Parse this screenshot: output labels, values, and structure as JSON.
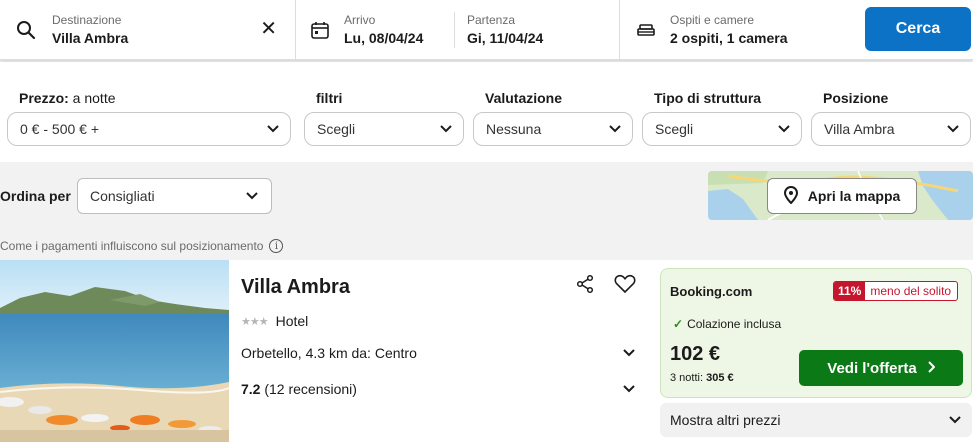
{
  "search": {
    "destination_label": "Destinazione",
    "destination_value": "Villa Ambra",
    "checkin_label": "Arrivo",
    "checkin_value": "Lu, 08/04/24",
    "checkout_label": "Partenza",
    "checkout_value": "Gi, 11/04/24",
    "guests_label": "Ospiti e camere",
    "guests_value": "2 ospiti, 1 camera",
    "search_button": "Cerca"
  },
  "filters": {
    "price_label": "Prezzo:",
    "price_sub": " a notte",
    "price_value": "0 € - 500 € +",
    "filters_label": "filtri",
    "filters_value": "Scegli",
    "rating_label": "Valutazione",
    "rating_value": "Nessuna",
    "type_label": "Tipo di struttura",
    "type_value": "Scegli",
    "position_label": "Posizione",
    "position_value": "Villa Ambra"
  },
  "sort": {
    "label": "Ordina per",
    "value": "Consigliati",
    "map_button": "Apri la mappa",
    "payment_note": "Come i pagamenti influiscono sul posizionamento"
  },
  "result": {
    "name": "Villa Ambra",
    "stars": 3,
    "star_glyphs": "★★★",
    "type": "Hotel",
    "location": "Orbetello, 4.3 km da: Centro",
    "rating_score": "7.2",
    "rating_count": "(12 recensioni)",
    "provider": "Booking.com",
    "deal_pct": "11%",
    "deal_text": "meno del solito",
    "breakfast": "Colazione inclusa",
    "price": "102 €",
    "total_prefix": "3 notti:",
    "total_value": "305 €",
    "offer_button": "Vedi l'offerta",
    "more_prices": "Mostra altri prezzi"
  },
  "colors": {
    "primary_blue": "#0b72c6",
    "offer_green": "#0b7a16",
    "deal_red": "#c5162e"
  }
}
